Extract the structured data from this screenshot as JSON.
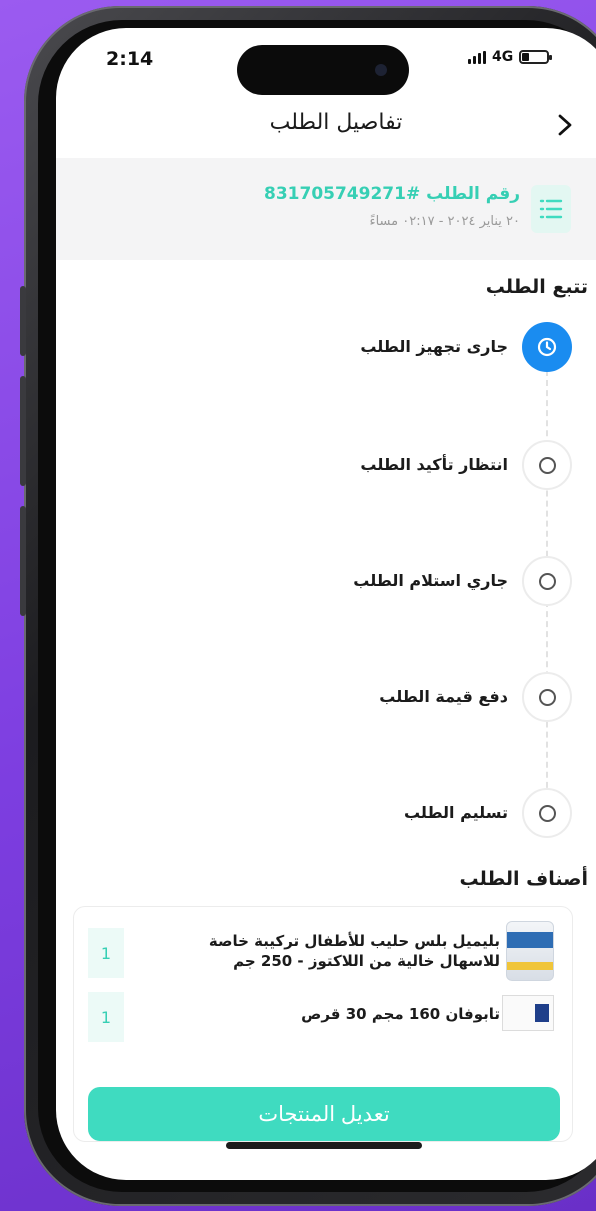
{
  "status_bar": {
    "time": "2:14",
    "network": "4G"
  },
  "header": {
    "title": "تفاصيل الطلب"
  },
  "order": {
    "number": "رقم الطلب #831705749271",
    "date": "٢٠ يناير ٢٠٢٤ - ٠٢:١٧ مساءً"
  },
  "tracking": {
    "title": "تتبع الطلب",
    "steps": [
      {
        "label": "جارى تجهيز الطلب",
        "state": "active"
      },
      {
        "label": "انتظار تأكيد الطلب",
        "state": "pending"
      },
      {
        "label": "جاري استلام الطلب",
        "state": "pending"
      },
      {
        "label": "دفع قيمة الطلب",
        "state": "pending"
      },
      {
        "label": "تسليم الطلب",
        "state": "pending"
      }
    ]
  },
  "items": {
    "title": "أصناف الطلب",
    "list": [
      {
        "name": "بليميل بلس حليب للأطفال تركيبة خاصة للاسهال خالية من اللاكتوز - 250 جم",
        "qty": "1"
      },
      {
        "name": "تابوفان 160 مجم 30 قرص",
        "qty": "1"
      }
    ],
    "edit_label": "تعديل المنتجات"
  },
  "colors": {
    "accent": "#3fdbc0",
    "active_step": "#1a8cf0",
    "order_number": "#36cfb4"
  }
}
